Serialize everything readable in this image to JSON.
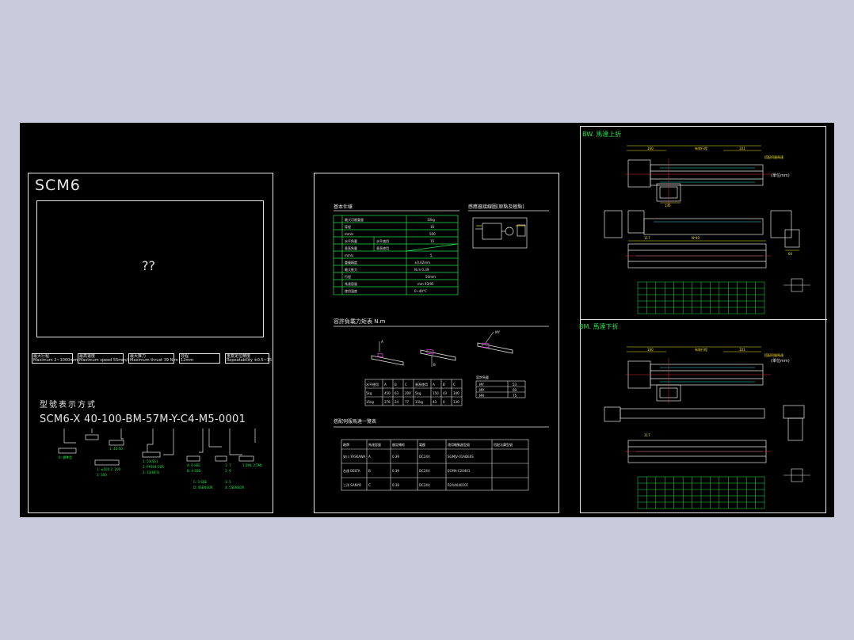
{
  "panel_left": {
    "title": "SCM6",
    "placeholder_text": "??",
    "spec_boxes": [
      {
        "line1": "最大行程",
        "line2": "Maximum 2~1000mm"
      },
      {
        "line1": "最高速度",
        "line2": "Maximum speed 55mm/s"
      },
      {
        "line1": "最大推力",
        "line2": "Maximum thrust 39 N.m"
      },
      {
        "line1": "导程",
        "line2": "12mm"
      },
      {
        "line1": "重复定位精度",
        "line2": "Repeatability ±0.5~15"
      }
    ],
    "model_heading": "型號表示方式",
    "model_code": "SCM6-X 40-100-BM-57M-Y-C4-M5-0001"
  },
  "panel_middle": {
    "basic_spec_title": "基本仕樣",
    "wiring_title": "感應器接線圖(原點及極點)",
    "moment_title": "容許負載力矩表 N.m",
    "servo_title": "搭配伺服馬達一覽表",
    "moment_table": {
      "headers": [
        "水平使用",
        "A",
        "B",
        "C",
        "垂直使用",
        "A",
        "B",
        "C"
      ],
      "rows": [
        [
          "5kg",
          "450",
          "63",
          "200",
          "5kg",
          "150",
          "43",
          "340"
        ],
        [
          "15kg",
          "376",
          "24",
          "77",
          "15kg",
          "43",
          "0",
          "130"
        ]
      ]
    },
    "side_table": {
      "header": "容許負載",
      "rows": [
        [
          "MY",
          "53"
        ],
        [
          "MP",
          "69"
        ],
        [
          "MR",
          "75"
        ]
      ]
    },
    "servo_table": {
      "headers": [
        "廠牌",
        "馬達容量",
        "額定轉矩",
        "電壓",
        "適用驅動器型號",
        "搭配法蘭型號"
      ],
      "rows": [
        [
          "安川 YASKAWA",
          "A",
          "0.39",
          "DC24V",
          "SGMJV-01ADE6S"
        ],
        [
          "台達 DELTA",
          "B",
          "0.39",
          "DC24V",
          "ECMA-C20401"
        ],
        [
          "三洋 SANYO",
          "C",
          "0.39",
          "DC24V",
          "R2AA04010F"
        ]
      ]
    }
  },
  "panel_right": {
    "top_label": "BW. 馬達上折",
    "bottom_label": "BM. 馬達下折",
    "unit_note": "(單位mm)",
    "dim_160": "160",
    "dim_101": "101",
    "dim_117": "117",
    "stroke_label": "有效行程",
    "motor_label": "搭配伺服馬達"
  },
  "colors": {
    "background": "#c9cadc",
    "canvas": "#000000",
    "frame": "#e6e6e6",
    "green": "#22e34c",
    "yellow": "#f0e020",
    "cyan": "#3fd0e0",
    "red": "#e03030"
  }
}
